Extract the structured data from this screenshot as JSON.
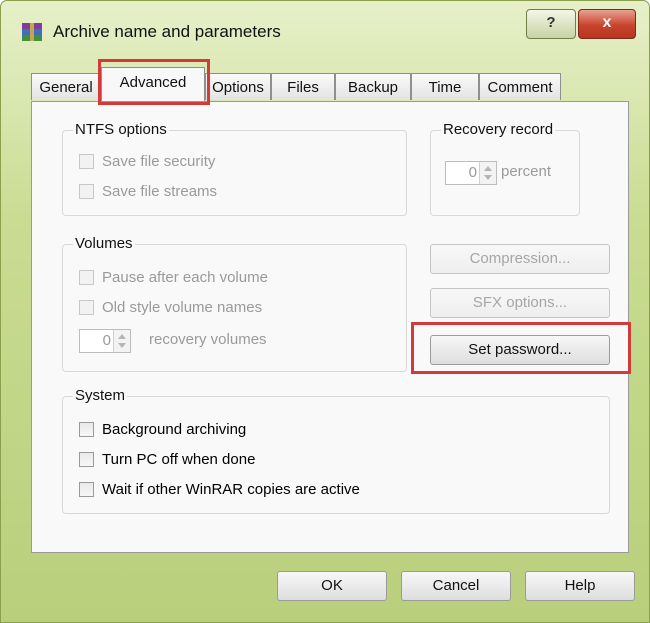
{
  "window": {
    "title": "Archive name and parameters",
    "help_label": "?",
    "close_label": "x",
    "app_icon": "winrar-books-icon"
  },
  "tabs": [
    {
      "label": "General"
    },
    {
      "label": "Advanced",
      "active": true
    },
    {
      "label": "Options"
    },
    {
      "label": "Files"
    },
    {
      "label": "Backup"
    },
    {
      "label": "Time"
    },
    {
      "label": "Comment"
    }
  ],
  "ntfs": {
    "title": "NTFS options",
    "save_security": "Save file security",
    "save_streams": "Save file streams"
  },
  "recovery": {
    "title": "Recovery record",
    "value": "0",
    "suffix": "percent"
  },
  "volumes": {
    "title": "Volumes",
    "pause": "Pause after each volume",
    "old_style": "Old style volume names",
    "recovery_value": "0",
    "recovery_suffix": "recovery volumes"
  },
  "buttons": {
    "compression": "Compression...",
    "sfx": "SFX options...",
    "set_password": "Set password...",
    "ok": "OK",
    "cancel": "Cancel",
    "help": "Help"
  },
  "system": {
    "title": "System",
    "background": "Background archiving",
    "turn_off": "Turn PC off when done",
    "wait": "Wait if other WinRAR copies are active"
  },
  "colors": {
    "highlight": "#d33b3b",
    "title_bar": "#c9dc92"
  }
}
